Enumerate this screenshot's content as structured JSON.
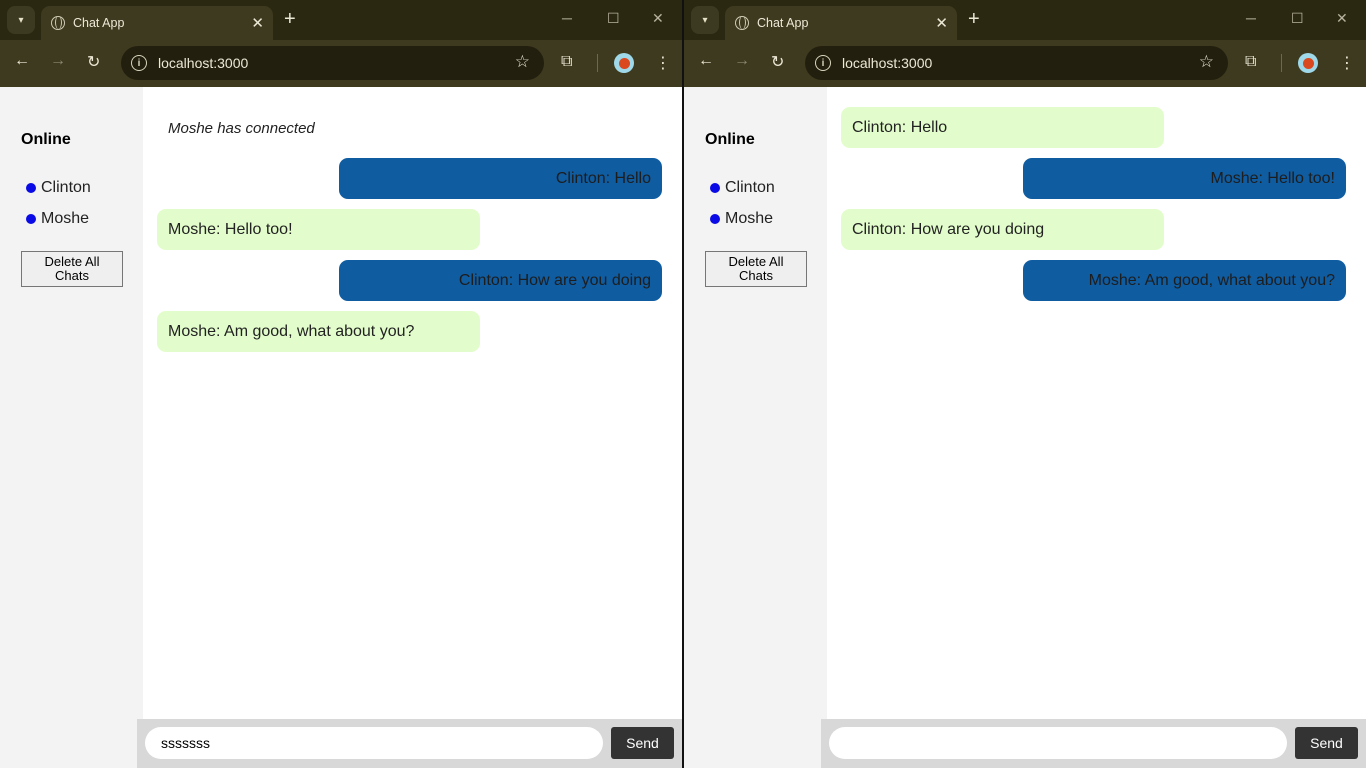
{
  "browser": {
    "tab_title": "Chat App",
    "url": "localhost:3000"
  },
  "colors": {
    "online_dot": "#0a0ae6",
    "bubble_received": "#e2fdcb",
    "bubble_sent": "#0f5ca1",
    "send_button": "#333333"
  },
  "left_window": {
    "sidebar": {
      "title": "Online",
      "users": [
        "Clinton",
        "Moshe"
      ],
      "delete_label_line1": "Delete All",
      "delete_label_line2": "Chats"
    },
    "system_message": "Moshe has connected",
    "messages": [
      {
        "side": "right",
        "text": "Clinton: Hello"
      },
      {
        "side": "left",
        "text": "Moshe: Hello too!"
      },
      {
        "side": "right",
        "text": "Clinton: How are you doing"
      },
      {
        "side": "left",
        "text": "Moshe: Am good, what about you?"
      }
    ],
    "composer": {
      "value": "sssssss",
      "send_label": "Send"
    }
  },
  "right_window": {
    "sidebar": {
      "title": "Online",
      "users": [
        "Clinton",
        "Moshe"
      ],
      "delete_label_line1": "Delete All",
      "delete_label_line2": "Chats"
    },
    "messages": [
      {
        "side": "left",
        "text": "Clinton: Hello"
      },
      {
        "side": "right",
        "text": "Moshe: Hello too!"
      },
      {
        "side": "left",
        "text": "Clinton: How are you doing"
      },
      {
        "side": "right",
        "text": "Moshe: Am good, what about you?"
      }
    ],
    "composer": {
      "value": "",
      "send_label": "Send"
    }
  }
}
